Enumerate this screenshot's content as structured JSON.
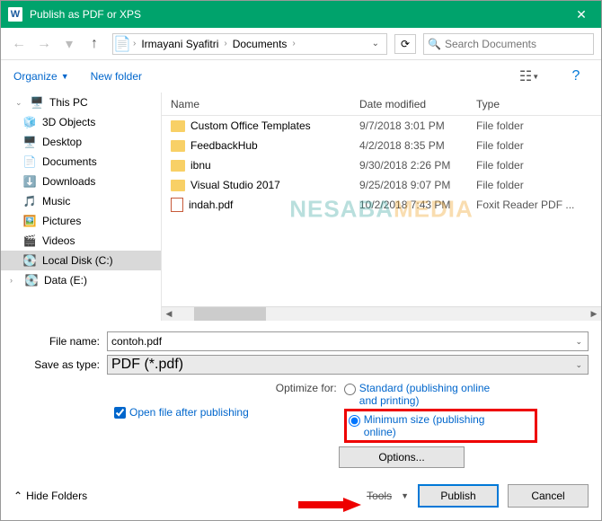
{
  "window": {
    "title": "Publish as PDF or XPS"
  },
  "breadcrumb": {
    "user": "Irmayani Syafitri",
    "folder": "Documents"
  },
  "search": {
    "placeholder": "Search Documents"
  },
  "toolbar": {
    "organize": "Organize",
    "new_folder": "New folder"
  },
  "sidebar": {
    "root": "This PC",
    "items": [
      {
        "label": "3D Objects"
      },
      {
        "label": "Desktop"
      },
      {
        "label": "Documents"
      },
      {
        "label": "Downloads"
      },
      {
        "label": "Music"
      },
      {
        "label": "Pictures"
      },
      {
        "label": "Videos"
      },
      {
        "label": "Local Disk (C:)"
      },
      {
        "label": "Data (E:)"
      }
    ]
  },
  "columns": {
    "name": "Name",
    "date": "Date modified",
    "type": "Type"
  },
  "files": [
    {
      "name": "Custom Office Templates",
      "date": "9/7/2018 3:01 PM",
      "type": "File folder",
      "kind": "folder"
    },
    {
      "name": "FeedbackHub",
      "date": "4/2/2018 8:35 PM",
      "type": "File folder",
      "kind": "folder"
    },
    {
      "name": "ibnu",
      "date": "9/30/2018 2:26 PM",
      "type": "File folder",
      "kind": "folder"
    },
    {
      "name": "Visual Studio 2017",
      "date": "9/25/2018 9:07 PM",
      "type": "File folder",
      "kind": "folder"
    },
    {
      "name": "indah.pdf",
      "date": "10/2/2018 7:43 PM",
      "type": "Foxit Reader PDF ...",
      "kind": "pdf"
    }
  ],
  "fields": {
    "file_name_label": "File name:",
    "file_name": "contoh.pdf",
    "save_type_label": "Save as type:",
    "save_type": "PDF (*.pdf)"
  },
  "options": {
    "open_after": "Open file after publishing",
    "optimize_label": "Optimize for:",
    "standard": "Standard (publishing online and printing)",
    "minimum": "Minimum size (publishing online)",
    "options_btn": "Options..."
  },
  "footer": {
    "hide_folders": "Hide Folders",
    "tools": "Tools",
    "publish": "Publish",
    "cancel": "Cancel"
  },
  "watermark": {
    "part1": "NESABA",
    "part2": "MEDIA"
  }
}
